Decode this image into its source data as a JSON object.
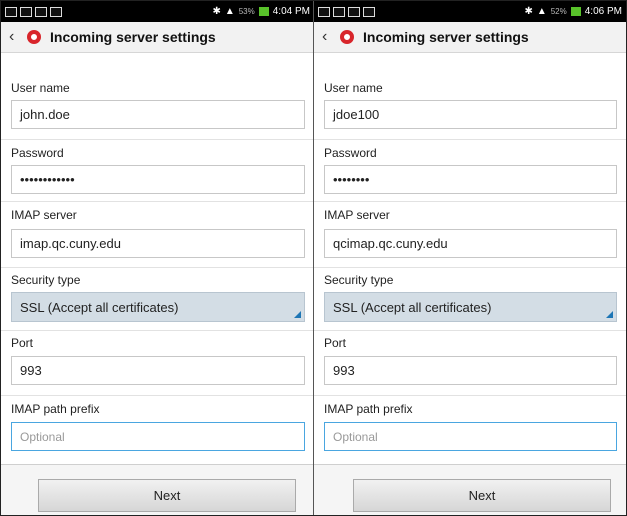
{
  "status_left": {
    "time": "4:04 PM",
    "battery_pct": "53%"
  },
  "status_right": {
    "time": "4:06 PM",
    "battery_pct": "52%"
  },
  "screen_left": {
    "title": "Incoming server settings",
    "username_label": "User name",
    "username_value": "john.doe",
    "password_label": "Password",
    "password_value": "••••••••••••",
    "imap_label": "IMAP server",
    "imap_value": "imap.qc.cuny.edu",
    "security_label": "Security type",
    "security_value": "SSL (Accept all certificates)",
    "port_label": "Port",
    "port_value": "993",
    "prefix_label": "IMAP path prefix",
    "prefix_placeholder": "Optional",
    "next_label": "Next"
  },
  "screen_right": {
    "title": "Incoming server settings",
    "username_label": "User name",
    "username_value": "jdoe100",
    "password_label": "Password",
    "password_value": "••••••••",
    "imap_label": "IMAP server",
    "imap_value": "qcimap.qc.cuny.edu",
    "security_label": "Security type",
    "security_value": "SSL (Accept all certificates)",
    "port_label": "Port",
    "port_value": "993",
    "prefix_label": "IMAP path prefix",
    "prefix_placeholder": "Optional",
    "next_label": "Next"
  },
  "icons": [
    "wifi-icon",
    "image-icon",
    "notification-icon",
    "mail-icon",
    "bluetooth-icon",
    "signal-icon",
    "battery-icon",
    "back-icon",
    "app-logo-icon",
    "dropdown-triangle-icon"
  ],
  "colors": {
    "accent": "#d8252b",
    "select_bg": "#d3dde5",
    "focus": "#4aa6e0",
    "triangle": "#1e76b5"
  }
}
